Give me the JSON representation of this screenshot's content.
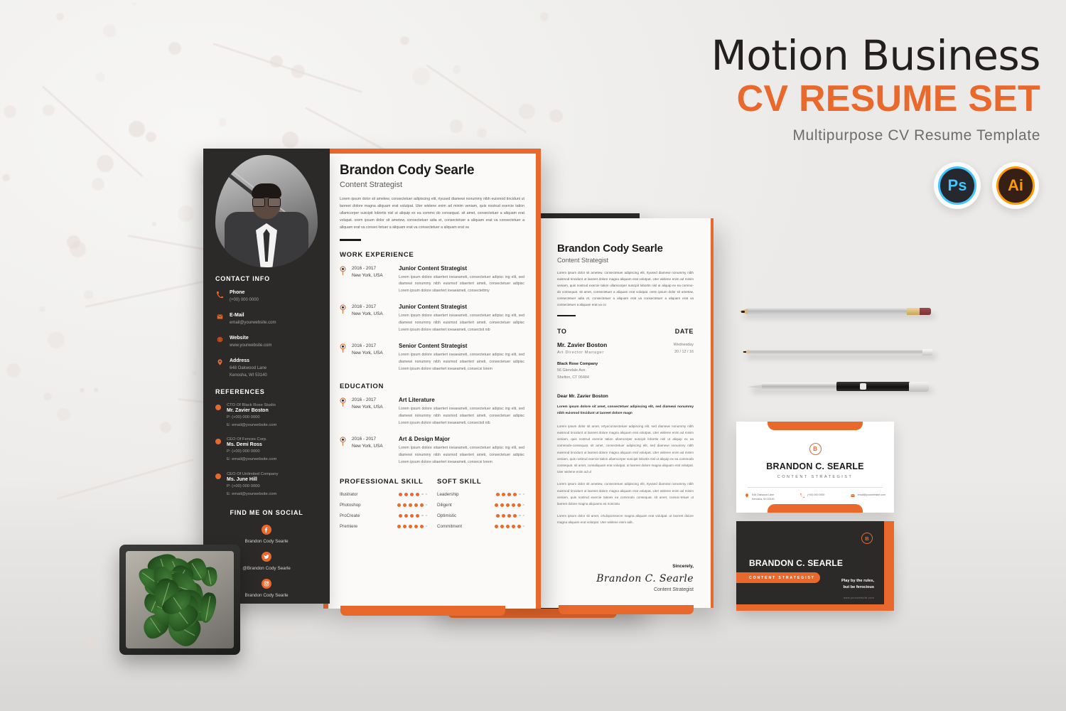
{
  "header": {
    "title": "Motion Business",
    "subtitle": "CV RESUME SET",
    "tagline": "Multipurpose CV Resume Template",
    "badges": [
      {
        "name": "photoshop-badge",
        "label": "Ps"
      },
      {
        "name": "illustrator-badge",
        "label": "Ai"
      }
    ]
  },
  "colors": {
    "accent": "#e9692c",
    "dark": "#2b2a29",
    "paper": "#fbfaf8",
    "background": "#f2f1f0",
    "ps_blue": "#45c5fb",
    "ai_orange": "#ff9a00"
  },
  "sidebar": {
    "contact_title": "CONTACT INFO",
    "contacts": [
      {
        "icon": "phone-icon",
        "label": "Phone",
        "value": "(+00) 000 0000"
      },
      {
        "icon": "mail-icon",
        "label": "E-Mail",
        "value": "email@yourwebsite.com"
      },
      {
        "icon": "globe-icon",
        "label": "Website",
        "value": "www.yourwebsite.com"
      },
      {
        "icon": "location-icon",
        "label": "Address",
        "value": "648 Oakwood Lane\nKenosha, WI 53140"
      }
    ],
    "references_title": "REFERENCES",
    "references": [
      {
        "org": "CTO Of Black Rose Studio",
        "name": "Mr.  Zavier Boston",
        "phone": "P: (+00) 000 0000",
        "email": "E: email@yourwebsite.com"
      },
      {
        "org": "CEO Of Fences Corp.",
        "name": "Ms. Demi Ross",
        "phone": "P: (+00) 000 0000",
        "email": "E: email@yourwebsite.com"
      },
      {
        "org": "CEO Of Unlimited Company",
        "name": "Ms. June Hill",
        "phone": "P: (+00) 000 0000",
        "email": "E: email@yourwebsite.com"
      }
    ],
    "social_title": "FIND ME ON SOCIAL",
    "socials": [
      {
        "icon": "facebook-icon",
        "handle": "Brandon Cody Searle"
      },
      {
        "icon": "twitter-icon",
        "handle": "@Brandon Cody Searle"
      },
      {
        "icon": "instagram-icon",
        "handle": "Brandon Cody Searle"
      }
    ]
  },
  "resume": {
    "name": "Brandon Cody Searle",
    "role": "Content Strategist",
    "intro": "Lorem ipsum dolor sit ametew, consectetuer adipiscing elit, rtyused diamewi nonummy nibh euismod tincidunt ut laoreet dolore magna aliquam erat volutpat. Uter wislene enim ad minim veniam, quis nostrud exercie tation ullamcorper suscipit lobortis nisl ut aliquip ex ea commo do consequat. sit amet, consectetuer a aliquam erat volupat. orem ipsum dolor sit ametew, consectetuer adia et, consectetuer a aliquam erat va  consectetuer a aliquam erat va consec-tetuer a aliquam erat va consectetuer a aliquam erat va",
    "work_title": "WORK EXPERIENCE",
    "work": [
      {
        "date": "2016 - 2017",
        "place": "New York, USA",
        "title": "Junior Content Strategist",
        "desc": "Lorem ipsum dolore sitaertert ioeaeameti, consectetuer adipisc ing elit, sed diamewi nonummy nibh euismod sitaertert ameti, consectetuer adipisc  Lorem ipsum dolore sitaertert ioeaeameti, consectettmy"
      },
      {
        "date": "2016 - 2017",
        "place": "New York, USA",
        "title": "Junior Content Strategist",
        "desc": "Lorem ipsum dolore sitaertert ioeaeameti, consectetuer adipisc ing elit, sed diamewi nonummy nibh euismod sitaertert ameti, consectetuer adipisc  Lorem ipsum dolore sitaertert ioeaeameti, consectsit nib"
      },
      {
        "date": "2016 - 2017",
        "place": "New York, USA",
        "title": "Senior Content Strategist",
        "desc": "Lorem ipsum dolore sitaertert ioeaeameti, consectetuer adipisc ing elit, sed diamewi nonummy nibh euismod sitaertert ameti, consectetuer adipisc  Lorem ipsum dolore sitaertert ioeaeameti, consecsi lorem"
      }
    ],
    "education_title": "EDUCATION",
    "education": [
      {
        "date": "2016 - 2017",
        "place": "New York, USA",
        "title": "Art Literature",
        "desc": "Lorem ipsum dolore sitaertert ioeaeameti, consectetuer adipisc ing elit, sed diamewi nonummy nibh euismod sitaertert ameti, consectetuer adipisc  Lorem ipsum dolore sitaertert ioeaeameti, consectsit nib"
      },
      {
        "date": "2016 - 2017",
        "place": "New York, USA",
        "title": "Art & Design Major",
        "desc": "Lorem ipsum dolore sitaertert ioeaeameti, consectetuer adipisc ing elit, sed diamewi nonummy nibh euismod sitaertert ameti, consectetuer adipisc  Lorem ipsum dolore sitaertert ioeaeameti, consecsi lorem"
      }
    ],
    "pro_skill_title": "PROFESSIONAL SKILL",
    "pro_skills": [
      {
        "label": "Illustrator",
        "value": 4,
        "max": 6
      },
      {
        "label": "Photoshop",
        "value": 5,
        "max": 6
      },
      {
        "label": "ProCreate",
        "value": 4,
        "max": 6
      },
      {
        "label": "Premiere",
        "value": 5,
        "max": 6
      }
    ],
    "soft_skill_title": "SOFT SKILL",
    "soft_skills": [
      {
        "label": "Leadership",
        "value": 4,
        "max": 6
      },
      {
        "label": "Diligent",
        "value": 5,
        "max": 6
      },
      {
        "label": "Optimistic",
        "value": 4,
        "max": 6
      },
      {
        "label": "Commitment",
        "value": 5,
        "max": 6
      }
    ]
  },
  "letter": {
    "name": "Brandon Cody Searle",
    "role": "Content Strategist",
    "intro": "Lorem ipsum dolor sit ametew, consectetuer adipiscing elit, rtyused diamewi nonummy nibh euismod tincidunt ut laoreet dolore magna aliquam erat volutpat. Uter wislene enim ad minim veniam, quis nostrud exercie tation ullamcorper suscipit lobortis nisl ut aliquip ex ea commo-do consequat. sit amet, consectetuer a aliquam erat volutpat. orem ipsum dolor sit ametew, consectetuer adia et, consectetuer a aliquam erat va  consectetuer a aliquam erat va consectetuer a aliquam erat va co",
    "to_heading": "TO",
    "date_heading": "DATE",
    "to_name": "Mr. Zavier Boston",
    "to_role": "Art Director Manager",
    "company": "Black Rose Company",
    "company_address": "56 Glendale Ave.\nShelton, CT 06484",
    "date_day": "Wednesday",
    "date_value": "20 / 12 / 16",
    "salutation": "Dear Mr. Zavier Boston",
    "lead": "Lorem ipsum dolore sit amet, consectetuer adipiscing elit, sed diamewi nonummy nibh euismod tincidunt ut laoreet dolore magn",
    "paragraphs": [
      "Lorem ipsum dolor sit amet, ertyuconsectetuer adipiscing elit, sed diamewi nonummy nibh euismod tincidunt ut laoreet dolore magna aliquam erat volutpat. Uter wislene enim ad minim veniam, quis nostrud exercie tation ullamcorper suscipit lobortis nisl ut aliquip ex ea commodo-consequat. sit amet, consectetuer adipiscing elit, sed diamewi nonummy nibh euismod tincidunt ut laoreet dolore magna aliquam erat volutpat. Uter wislene enim ad minim veniam, quis nostrud exercie tation ullamcorper suscipit lobortis nisl ut aliquip ex ea commodo consequat.  sit amet, consaliquam erat volutpat.  ut laoreet dolore magna aliquam erat volutpat. Uter wislene enim ad ul",
      "Lorem ipsum dolor sit ametew, consectetuer adipiscing elit, rtyused diamewi nonummy nibh euismod tincidunt ut laoreet dolore magna aliquam erat volutpat. Uter wislene enim ad minim veniam, quis nostrud exercie tatioex ea commodo consequat. sit amet, consoc-tetuer  ut laoreet dolore magna aliquamx ea nosctotu",
      "Lorem ipsum dolor sit amet, crtulopomsecre magna aliquam erat volutpat.   ut laoreet dolore magna aliquam erat volutpat. Uter wislene enim adit.."
    ],
    "closing": "Sincerely,",
    "signature": "Brandon C. Searle",
    "signature_role": "Content Strategist"
  },
  "business_card_white": {
    "logo": "B",
    "name": "BRANDON C. SEARLE",
    "role": "CONTENT STRATEGIST",
    "details": [
      {
        "icon": "location-icon",
        "text": "648 Oakwood Lane\nKenosha, WI 53140"
      },
      {
        "icon": "phone-icon",
        "text": "(+00) 000 0000"
      },
      {
        "icon": "mail-icon",
        "text": "email@yourwebsite.com"
      }
    ]
  },
  "business_card_dark": {
    "logo": "B",
    "name": "BRANDON C. SEARLE",
    "role": "CONTENT STRATEGIST",
    "slogan": "Play by the rules,\nbut be ferocious",
    "website": "www.yourwebsite.com"
  },
  "props": {
    "pencil_top": "pencil",
    "pencil_mid": "mechanical-pencil",
    "pen": "ballpoint-pen",
    "plant": "fittonia-potted-plant"
  }
}
